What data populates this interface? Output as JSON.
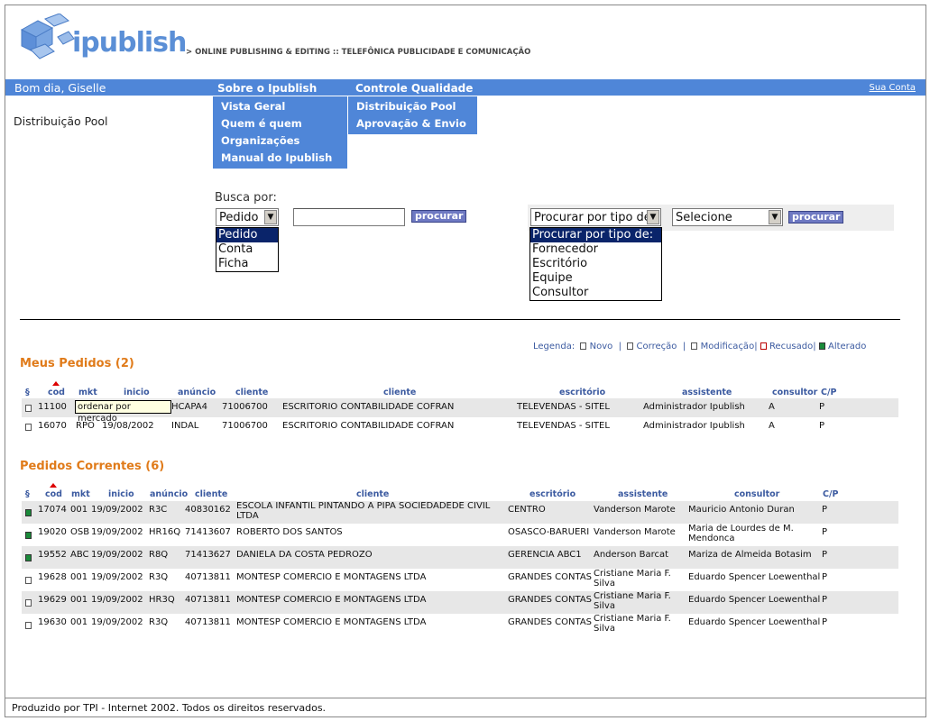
{
  "header": {
    "logo_text": "ipublish",
    "tagline": "> ONLINE PUBLISHING & EDITING :: TELEFÔNICA PUBLICIDADE E COMUNICAÇÃO"
  },
  "nav": {
    "greeting": "Bom dia, Giselle",
    "menu_sobre": "Sobre o Ipublish",
    "menu_controle": "Controle Qualidade",
    "account": "Sua Conta",
    "sobre_items": [
      "Vista Geral",
      "Quem é quem",
      "Organizações",
      "Manual do Ipublish"
    ],
    "controle_items": [
      "Distribuição Pool",
      "Aprovação & Envio"
    ]
  },
  "page_title": "Distribuição Pool",
  "search": {
    "label": "Busca por:",
    "field_selected": "Pedido",
    "field_options": [
      "Pedido",
      "Conta",
      "Ficha"
    ],
    "text_value": "",
    "button": "procurar",
    "type_selected": "Procurar por tipo de:",
    "type_options": [
      "Procurar por tipo de:",
      "Fornecedor",
      "Escritório",
      "Equipe",
      "Consultor"
    ],
    "second_selected": "Selecione",
    "button2": "procurar"
  },
  "legend": {
    "label": "Legenda:",
    "novo": "Novo",
    "correcao": "Correção",
    "modificacao": "Modificação",
    "recusado": "Recusado",
    "alterado": "Alterado"
  },
  "meus": {
    "title": "Meus Pedidos (2)",
    "headers": [
      "§",
      "cod",
      "mkt",
      "inicio",
      "anúncio",
      "cliente",
      "cliente",
      "escritório",
      "assistente",
      "consultor",
      "C/P"
    ],
    "tooltip": "ordenar por mercado",
    "rows": [
      {
        "cod": "11100",
        "mkt": "",
        "inicio": "",
        "anuncio": "HCAPA4",
        "cliente_id": "71006700",
        "cliente": "ESCRITORIO CONTABILIDADE COFRAN",
        "escritorio": "TELEVENDAS - SITEL",
        "assistente": "Administrador Ipublish",
        "consultor": "A",
        "cp": "P"
      },
      {
        "cod": "16070",
        "mkt": "RPO",
        "inicio": "19/08/2002",
        "anuncio": "INDAL",
        "cliente_id": "71006700",
        "cliente": "ESCRITORIO CONTABILIDADE COFRAN",
        "escritorio": "TELEVENDAS - SITEL",
        "assistente": "Administrador Ipublish",
        "consultor": "A",
        "cp": "P"
      }
    ]
  },
  "correntes": {
    "title": "Pedidos Correntes (6)",
    "headers": [
      "§",
      "cod",
      "mkt",
      "inicio",
      "anúncio",
      "cliente",
      "cliente",
      "escritório",
      "assistente",
      "consultor",
      "C/P"
    ],
    "rows": [
      {
        "cod": "17074",
        "mkt": "001",
        "inicio": "19/09/2002",
        "anuncio": "R3C",
        "cliente_id": "40830162",
        "cliente": "ESCOLA INFANTIL PINTANDO A PIPA SOCIEDADEDE CIVIL LTDA",
        "escritorio": "CENTRO",
        "assistente": "Vanderson Marote",
        "consultor": "Mauricio Antonio Duran",
        "cp": "P"
      },
      {
        "cod": "19020",
        "mkt": "OSB",
        "inicio": "19/09/2002",
        "anuncio": "HR16Q",
        "cliente_id": "71413607",
        "cliente": "ROBERTO DOS SANTOS",
        "escritorio": "OSASCO-BARUERI",
        "assistente": "Vanderson Marote",
        "consultor": "Maria de Lourdes de M. Mendonca",
        "cp": "P"
      },
      {
        "cod": "19552",
        "mkt": "ABC",
        "inicio": "19/09/2002",
        "anuncio": "R8Q",
        "cliente_id": "71413627",
        "cliente": "DANIELA DA COSTA PEDROZO",
        "escritorio": "GERENCIA ABC1",
        "assistente": "Anderson Barcat",
        "consultor": "Mariza de Almeida Botasim",
        "cp": "P"
      },
      {
        "cod": "19628",
        "mkt": "001",
        "inicio": "19/09/2002",
        "anuncio": "R3Q",
        "cliente_id": "40713811",
        "cliente": "MONTESP COMERCIO E MONTAGENS LTDA",
        "escritorio": "GRANDES CONTAS",
        "assistente": "Cristiane Maria F. Silva",
        "consultor": "Eduardo Spencer Loewenthal",
        "cp": "P"
      },
      {
        "cod": "19629",
        "mkt": "001",
        "inicio": "19/09/2002",
        "anuncio": "HR3Q",
        "cliente_id": "40713811",
        "cliente": "MONTESP COMERCIO E MONTAGENS LTDA",
        "escritorio": "GRANDES CONTAS",
        "assistente": "Cristiane Maria F. Silva",
        "consultor": "Eduardo Spencer Loewenthal",
        "cp": "P"
      },
      {
        "cod": "19630",
        "mkt": "001",
        "inicio": "19/09/2002",
        "anuncio": "R3Q",
        "cliente_id": "40713811",
        "cliente": "MONTESP COMERCIO E MONTAGENS LTDA",
        "escritorio": "GRANDES CONTAS",
        "assistente": "Cristiane Maria F. Silva",
        "consultor": "Eduardo Spencer Loewenthal",
        "cp": "P"
      }
    ]
  },
  "footer": "Produzido por TPI - Internet 2002. Todos os direitos reservados."
}
